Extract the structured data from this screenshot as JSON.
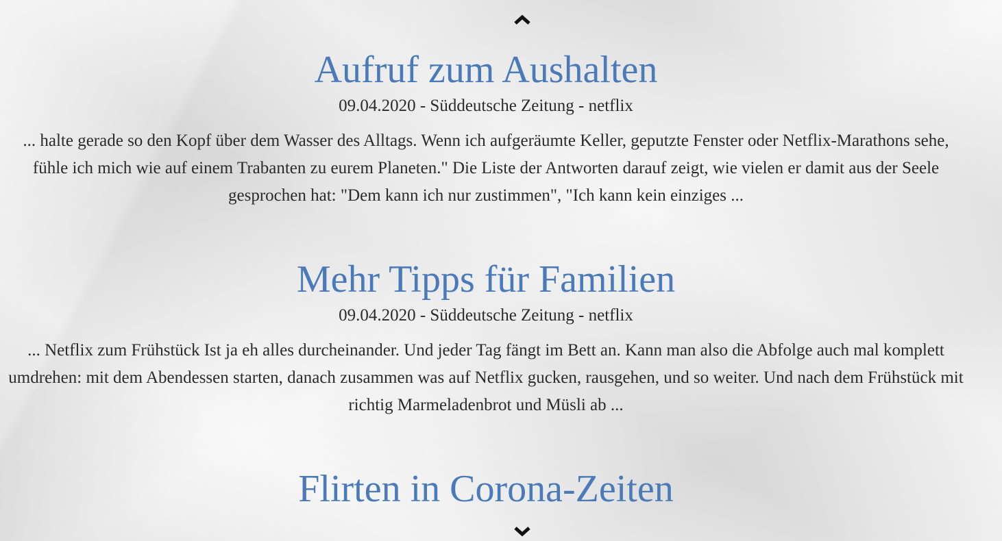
{
  "navigation": {
    "up_icon": "chevron-up-icon",
    "down_icon": "chevron-down-icon"
  },
  "articles": [
    {
      "title": "Aufruf zum Aushalten",
      "meta": "09.04.2020 - Süddeutsche Zeitung - netflix",
      "excerpt": "... halte gerade so den Kopf über dem Wasser des Alltags. Wenn ich aufgeräumte Keller, geputzte Fenster oder Netflix-Marathons sehe, fühle ich mich wie auf einem Trabanten zu eurem Planeten.\" Die Liste der Antworten darauf zeigt, wie vielen er damit aus der Seele gesprochen hat: \"Dem kann ich nur zustimmen\", \"Ich kann kein einziges ..."
    },
    {
      "title": "Mehr Tipps für Familien",
      "meta": "09.04.2020 - Süddeutsche Zeitung - netflix",
      "excerpt": "... Netflix zum Frühstück Ist ja eh alles durcheinander. Und jeder Tag fängt im Bett an. Kann man also die Abfolge auch mal komplett umdrehen: mit dem Abendessen starten, danach zusammen was auf Netflix gucken, rausgehen, und so weiter. Und nach dem Frühstück mit richtig Marmeladenbrot und Müsli ab ..."
    },
    {
      "title": "Flirten in Corona-Zeiten"
    }
  ],
  "colors": {
    "title": "#4a7ab8",
    "text": "#2b2b2b",
    "background": "#e9e9ea"
  }
}
